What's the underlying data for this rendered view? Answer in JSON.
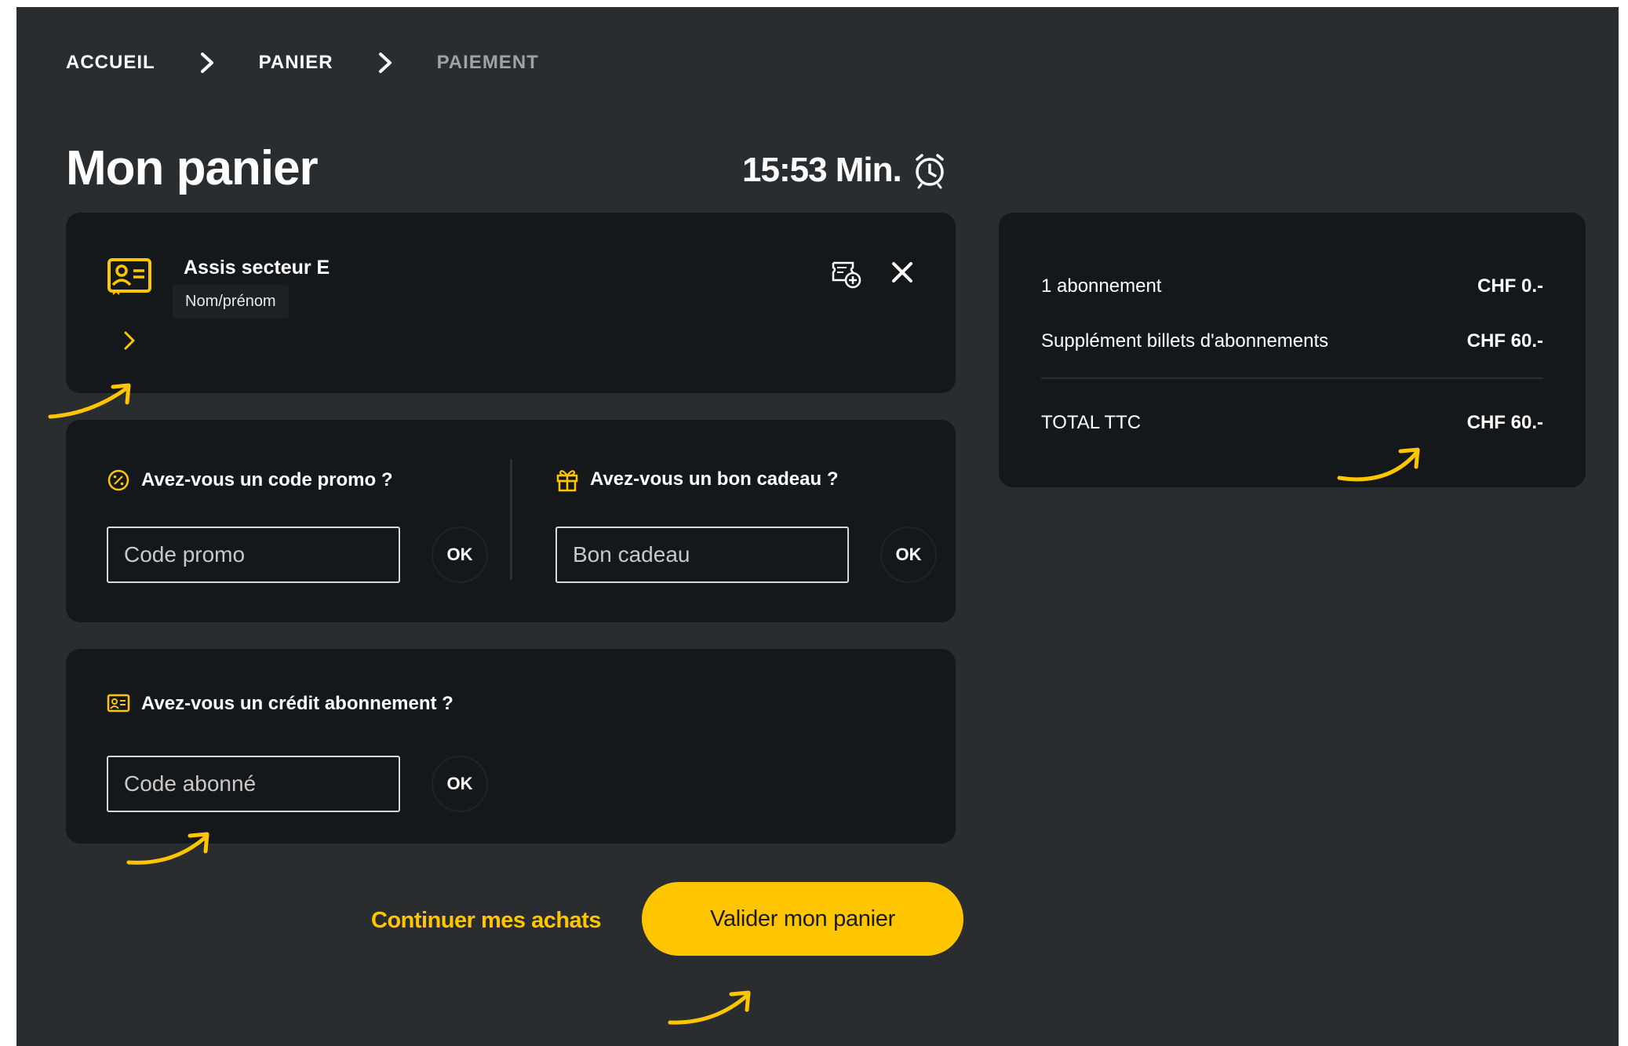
{
  "breadcrumb": {
    "items": [
      {
        "label": "ACCUEIL"
      },
      {
        "label": "PANIER"
      },
      {
        "label": "PAIEMENT"
      }
    ]
  },
  "header": {
    "title": "Mon panier",
    "timer": "15:53 Min."
  },
  "ticket": {
    "title": "Assis secteur E",
    "subtitle": "Nom/prénom"
  },
  "promo": {
    "label": "Avez-vous un code promo ?",
    "placeholder": "Code promo",
    "ok": "OK"
  },
  "gift": {
    "label": "Avez-vous un bon cadeau ?",
    "placeholder": "Bon cadeau",
    "ok": "OK"
  },
  "subscription": {
    "label": "Avez-vous un crédit abonnement ?",
    "placeholder": "Code abonné",
    "ok": "OK"
  },
  "summary": {
    "rows": [
      {
        "label": "1 abonnement",
        "amount": "CHF 0.-"
      },
      {
        "label": "Supplément billets d'abonnements",
        "amount": "CHF 60.-"
      }
    ],
    "total": {
      "label": "TOTAL TTC",
      "amount": "CHF 60.-"
    }
  },
  "actions": {
    "continue": "Continuer mes achats",
    "validate": "Valider mon panier"
  },
  "colors": {
    "accent": "#ffc600",
    "page_bg": "#2a2d30",
    "card_bg": "#15181b"
  }
}
